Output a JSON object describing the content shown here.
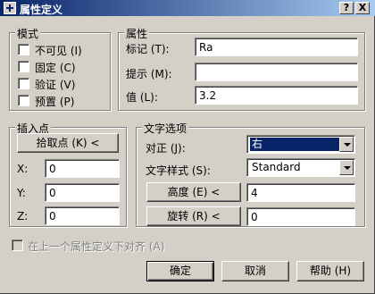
{
  "window": {
    "title": "属性定义"
  },
  "titlebar": {
    "help": "?",
    "close": "X"
  },
  "mode": {
    "legend": "模式",
    "items": [
      {
        "label": "不可见 (I)",
        "checked": false
      },
      {
        "label": "固定 (C)",
        "checked": false
      },
      {
        "label": "验证 (V)",
        "checked": false
      },
      {
        "label": "预置 (P)",
        "checked": false
      }
    ]
  },
  "attributes": {
    "legend": "属性",
    "tag_label": "标记 (T):",
    "tag_value": "Ra",
    "prompt_label": "提示 (M):",
    "prompt_value": "",
    "value_label": "值 (L):",
    "value_value": "3.2"
  },
  "insertion": {
    "legend": "插入点",
    "pick_button": "拾取点 (K) <",
    "x_label": "X:",
    "x_value": "0",
    "y_label": "Y:",
    "y_value": "0",
    "z_label": "Z:",
    "z_value": "0"
  },
  "text_options": {
    "legend": "文字选项",
    "justify_label": "对正 (J):",
    "justify_value": "右",
    "style_label": "文字样式 (S):",
    "style_value": "Standard",
    "height_button": "高度 (E) <",
    "height_value": "4",
    "rotation_button": "旋转 (R) <",
    "rotation_value": "0"
  },
  "align_below": {
    "label": "在上一个属性定义下对齐 (A)",
    "checked": false
  },
  "buttons": {
    "ok": "确定",
    "cancel": "取消",
    "help": "帮助 (H)"
  }
}
